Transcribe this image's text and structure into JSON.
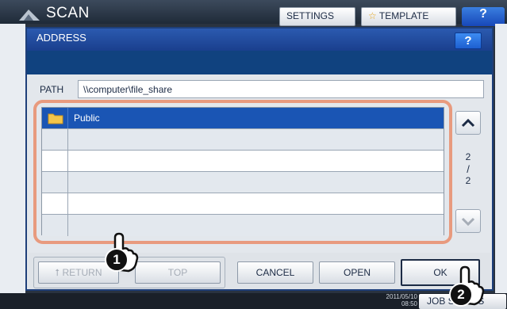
{
  "background": {
    "title": "SCAN",
    "settings_label": "SETTINGS",
    "template_label": "TEMPLATE",
    "help_label": "?",
    "clock_date": "2011/05/10",
    "clock_time": "08:50",
    "job_status_label": "JOB STATUS"
  },
  "dialog": {
    "title": "ADDRESS",
    "help_label": "?",
    "path_label": "PATH",
    "path_value": "\\\\computer\\file_share",
    "rows": [
      {
        "name": "Public",
        "selected": true
      },
      {
        "name": ""
      },
      {
        "name": ""
      },
      {
        "name": ""
      },
      {
        "name": ""
      },
      {
        "name": ""
      }
    ],
    "page_current": "2",
    "page_total": "2",
    "buttons": {
      "return": "RETURN",
      "top": "TOP",
      "cancel": "CANCEL",
      "open": "OPEN",
      "ok": "OK"
    }
  },
  "callouts": {
    "step1": "1",
    "step2": "2"
  },
  "colors": {
    "dialog_header": "#1a3f8d",
    "selection": "#1a55b4",
    "highlight_frame": "#e89a7e"
  }
}
